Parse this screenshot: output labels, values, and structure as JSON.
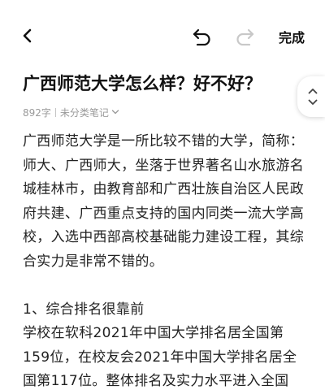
{
  "toolbar": {
    "back_icon": "chevron-left-icon",
    "undo_icon": "undo-icon",
    "redo_icon": "redo-icon",
    "redo_enabled": false,
    "done_label": "完成"
  },
  "note": {
    "title": "广西师范大学怎么样？好不好？",
    "word_count": "892字",
    "category": "未分类笔记",
    "paragraphs": [
      "广西师范大学是一所比较不错的大学，简称：师大、广西师大，坐落于世界著名山水旅游名城桂林市，由教育部和广西壮族自治区人民政府共建、广西重点支持的国内同类一流大学高校，入选中西部高校基础能力建设工程，其综合实力是非常不错的。",
      "1、综合排名很靠前",
      "学校在软科2021年中国大学排名居全国第159位，在校友会2021年中国大学排名居全国第117位。整体排名及实力水平进入全国"
    ]
  },
  "scroll_control": {
    "up_icon": "chevron-up-icon",
    "down_icon": "chevron-down-icon"
  },
  "colors": {
    "text": "#222222",
    "meta": "#9a9a9a",
    "disabled_icon": "#c8c8c8"
  }
}
